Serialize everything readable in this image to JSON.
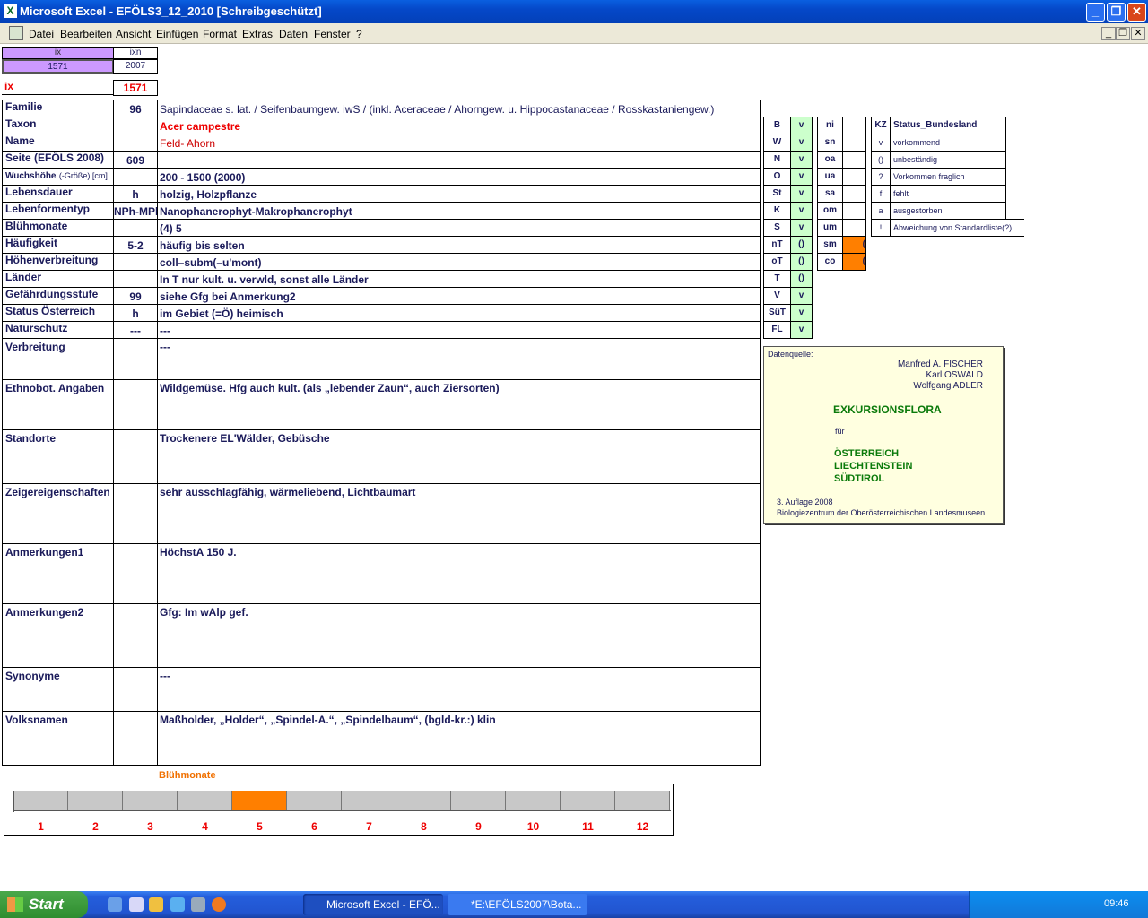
{
  "window": {
    "title": "Microsoft Excel - EFÖLS3_12_2010  [Schreibgeschützt]",
    "min": "_",
    "max": "❐",
    "close": "✕"
  },
  "menu": [
    "Datei",
    "Bearbeiten",
    "Ansicht",
    "Einfügen",
    "Format",
    "Extras",
    "Daten",
    "Fenster",
    "?"
  ],
  "mdi": {
    "min": "_",
    "max": "❐",
    "close": "✕"
  },
  "top": {
    "ix_label": "ix",
    "ixn_label": "ixn",
    "ix_val": "1571",
    "ixn_val": "2007",
    "ix_red": "ix",
    "ix_red_val": "1571"
  },
  "rows": [
    {
      "label": "Familie",
      "code": "96",
      "value": "Sapindaceae s. lat.  /  Seifenbaumgew. iwS / (inkl. Aceraceae / Ahorngew. u. Hippocastanaceae / Rosskastaniengew.)"
    },
    {
      "label": "Taxon",
      "code": "",
      "value": "Acer campestre"
    },
    {
      "label": "Name",
      "code": "",
      "value": "Feld- Ahorn"
    },
    {
      "label": "Seite (EFÖLS 2008)",
      "code": "609",
      "value": ""
    },
    {
      "label": "Wuchshöhe",
      "label2": "(-Größe) [cm]",
      "code": "",
      "value": "200 - 1500 (2000)"
    },
    {
      "label": "Lebensdauer",
      "code": "h",
      "value": "holzig, Holzpflanze"
    },
    {
      "label": "Lebenformentyp",
      "code": "NPh-MPh",
      "value": "Nanophanerophyt-Makrophanerophyt"
    },
    {
      "label": "Blühmonate",
      "code": "",
      "value": "(4) 5"
    },
    {
      "label": "Häufigkeit",
      "code": "5-2",
      "value": "häufig bis selten"
    },
    {
      "label": "Höhenverbreitung",
      "code": "",
      "value": "coll–subm(–u'mont)"
    },
    {
      "label": "Länder",
      "code": "",
      "value": "In T nur kult. u. verwld, sonst alle Länder"
    },
    {
      "label": "Gefährdungsstufe",
      "code": "99",
      "value": "siehe Gfg bei Anmerkung2"
    },
    {
      "label": "Status Österreich",
      "code": "h",
      "value": "im Gebiet (=Ö) heimisch"
    },
    {
      "label": "Naturschutz",
      "code": "---",
      "value": "---"
    }
  ],
  "big_rows": [
    {
      "label": "Verbreitung",
      "value": "---"
    },
    {
      "label": "Ethnobot. Angaben",
      "value": "Wildgemüse. Hfg auch kult. (als „lebender Zaun“, auch Ziersorten)"
    },
    {
      "label": "Standorte",
      "value": "Trockenere EL'Wälder, Gebüsche"
    },
    {
      "label": "Zeigereigenschaften",
      "value": "sehr ausschlagfähig, wärmeliebend, Lichtbaumart"
    },
    {
      "label": "Anmerkungen1",
      "value": "HöchstA 150 J."
    },
    {
      "label": "Anmerkungen2",
      "value": "Gfg: Im wAlp gef."
    },
    {
      "label": "Synonyme",
      "value": "---"
    },
    {
      "label": "Volksnamen",
      "value": "Maßholder,  „Holder“, „Spindel-A.“, „Spindelbaum“, (bgld-kr.:) klin"
    }
  ],
  "states": [
    {
      "k": "B",
      "v": "v"
    },
    {
      "k": "W",
      "v": "v"
    },
    {
      "k": "N",
      "v": "v"
    },
    {
      "k": "O",
      "v": "v"
    },
    {
      "k": "St",
      "v": "v"
    },
    {
      "k": "K",
      "v": "v"
    },
    {
      "k": "S",
      "v": "v"
    },
    {
      "k": "nT",
      "v": "()"
    },
    {
      "k": "oT",
      "v": "()"
    },
    {
      "k": "T",
      "v": "()"
    },
    {
      "k": "V",
      "v": "v"
    },
    {
      "k": "SüT",
      "v": "v"
    },
    {
      "k": "FL",
      "v": "v"
    }
  ],
  "regions": [
    {
      "k": "ni",
      "v": ""
    },
    {
      "k": "sn",
      "v": ""
    },
    {
      "k": "oa",
      "v": ""
    },
    {
      "k": "ua",
      "v": ""
    },
    {
      "k": "sa",
      "v": ""
    },
    {
      "k": "om",
      "v": ""
    },
    {
      "k": "um",
      "v": ""
    },
    {
      "k": "sm",
      "v": "(",
      "hl": true
    },
    {
      "k": "co",
      "v": "(",
      "hl": true
    }
  ],
  "legend": {
    "kz": "KZ",
    "title": "Status_Bundesland",
    "items": [
      {
        "k": "v",
        "t": "vorkommend"
      },
      {
        "k": "()",
        "t": "unbeständig"
      },
      {
        "k": "?",
        "t": "Vorkommen fraglich"
      },
      {
        "k": "f",
        "t": "fehlt"
      },
      {
        "k": "a",
        "t": "ausgestorben"
      },
      {
        "k": "!",
        "t": "Abweichung von Standardliste(?)"
      }
    ]
  },
  "source": {
    "label": "Datenquelle:",
    "authors": [
      "Manfred A. FISCHER",
      "Karl OSWALD",
      "Wolfgang ADLER"
    ],
    "title": "EXKURSIONSFLORA",
    "fuer": "für",
    "countries": [
      "ÖSTERREICH",
      "LIECHTENSTEIN",
      "SÜDTIROL"
    ],
    "edition": "3. Auflage 2008",
    "publisher": "Biologiezentrum der Oberösterreichischen Landesmuseen"
  },
  "bloom": {
    "title": "Blühmonate",
    "months": [
      "1",
      "2",
      "3",
      "4",
      "5",
      "6",
      "7",
      "8",
      "9",
      "10",
      "11",
      "12"
    ],
    "active": [
      5
    ]
  },
  "colors": {
    "bloom_active": "#ff7f00",
    "bloom_inactive": "#c8c8c8"
  },
  "taskbar": {
    "start": "Start",
    "tasks": [
      "Microsoft Excel - EFÖ...",
      "*E:\\EFÖLS2007\\Bota..."
    ],
    "clock": "09:46"
  }
}
